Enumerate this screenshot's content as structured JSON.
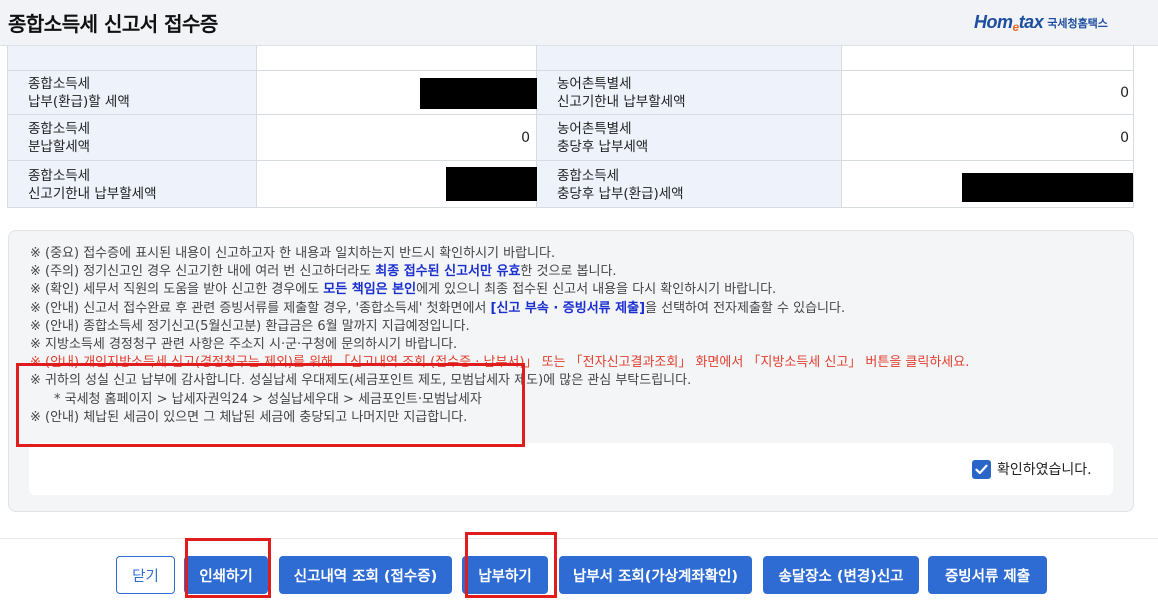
{
  "header": {
    "title": "종합소득세 신고서 접수증",
    "logo_mark": "Hom",
    "logo_mark_e": "e",
    "logo_mark_tail": "tax",
    "logo_text": "국세청홈택스"
  },
  "table": {
    "rows": [
      {
        "left_label": [
          "종합소득세",
          "납부(환급)할 세액"
        ],
        "left_value": "",
        "right_label": [
          "농어촌특별세",
          "신고기한내 납부할세액"
        ],
        "right_value": "0"
      },
      {
        "left_label": [
          "종합소득세",
          "분납할세액"
        ],
        "left_value": "0",
        "right_label": [
          "농어촌특별세",
          "충당후 납부세액"
        ],
        "right_value": "0"
      },
      {
        "left_label": [
          "종합소득세",
          "신고기한내 납부할세액"
        ],
        "left_value": "",
        "right_label": [
          "종합소득세",
          "충당후 납부(환급)세액"
        ],
        "right_value": ""
      }
    ]
  },
  "notices": {
    "n1": "※ (중요) 접수증에 표시된 내용이 신고하고자 한 내용과 일치하는지 반드시 확인하시기 바랍니다.",
    "n2_a": "※ (주의) 정기신고인 경우 신고기한 내에 여러 번 신고하더라도 ",
    "n2_hl": "최종 접수된 신고서만 유효",
    "n2_b": "한 것으로 봅니다.",
    "n3_a": "※ (확인) 세무서 직원의 도움을 받아 신고한 경우에도 ",
    "n3_hl": "모든 책임은 본인",
    "n3_b": "에게 있으니 최종 접수된 신고서 내용을 다시 확인하시기 바랍니다.",
    "n4_a": "※ (안내) 신고서 접수완료 후 관련 증빙서류를 제출할 경우, '종합소득세' 첫화면에서 ",
    "n4_hl": "[신고 부속 · 증빙서류 제출]",
    "n4_b": "을 선택하여 전자제출할 수 있습니다.",
    "n5": "※ (안내) 종합소득세 정기신고(5월신고분) 환급금은 6월 말까지 지급예정입니다.",
    "n6": "※ 지방소득세 경정청구 관련 사항은 주소지 시·군·구청에 문의하시기 바랍니다.",
    "n7": "※ (안내) 개인지방소득세 신고(경정청구는 제외)를 위해 「신고내역 조회 (접수증 · 납부서)」 또는 「전자신고결과조회」 화면에서 「지방소득세 신고」 버튼을 클릭하세요.",
    "n8": "※ 귀하의 성실 신고 납부에 감사합니다. 성실납세 우대제도(세금포인트 제도, 모범납세자 제도)에 많은 관심 부탁드립니다.",
    "n9": "* 국세청 홈페이지 > 납세자권익24 > 성실납세우대 > 세금포인트·모범납세자",
    "n10": "※ (안내) 체납된 세금이 있으면 그 체납된 세금에 충당되고 나머지만 지급합니다."
  },
  "confirm": {
    "label": "확인하였습니다.",
    "checked": true
  },
  "buttons": {
    "close": "닫기",
    "print": "인쇄하기",
    "history": "신고내역 조회 (접수증)",
    "pay": "납부하기",
    "bill": "납부서 조회(가상계좌확인)",
    "address": "송달장소 (변경)신고",
    "evidence": "증빙서류 제출"
  },
  "colors": {
    "primary": "#2e6cd4",
    "highlight": "#1a2fd0",
    "warning": "#e0402f",
    "annotation": "#e11c1c"
  }
}
